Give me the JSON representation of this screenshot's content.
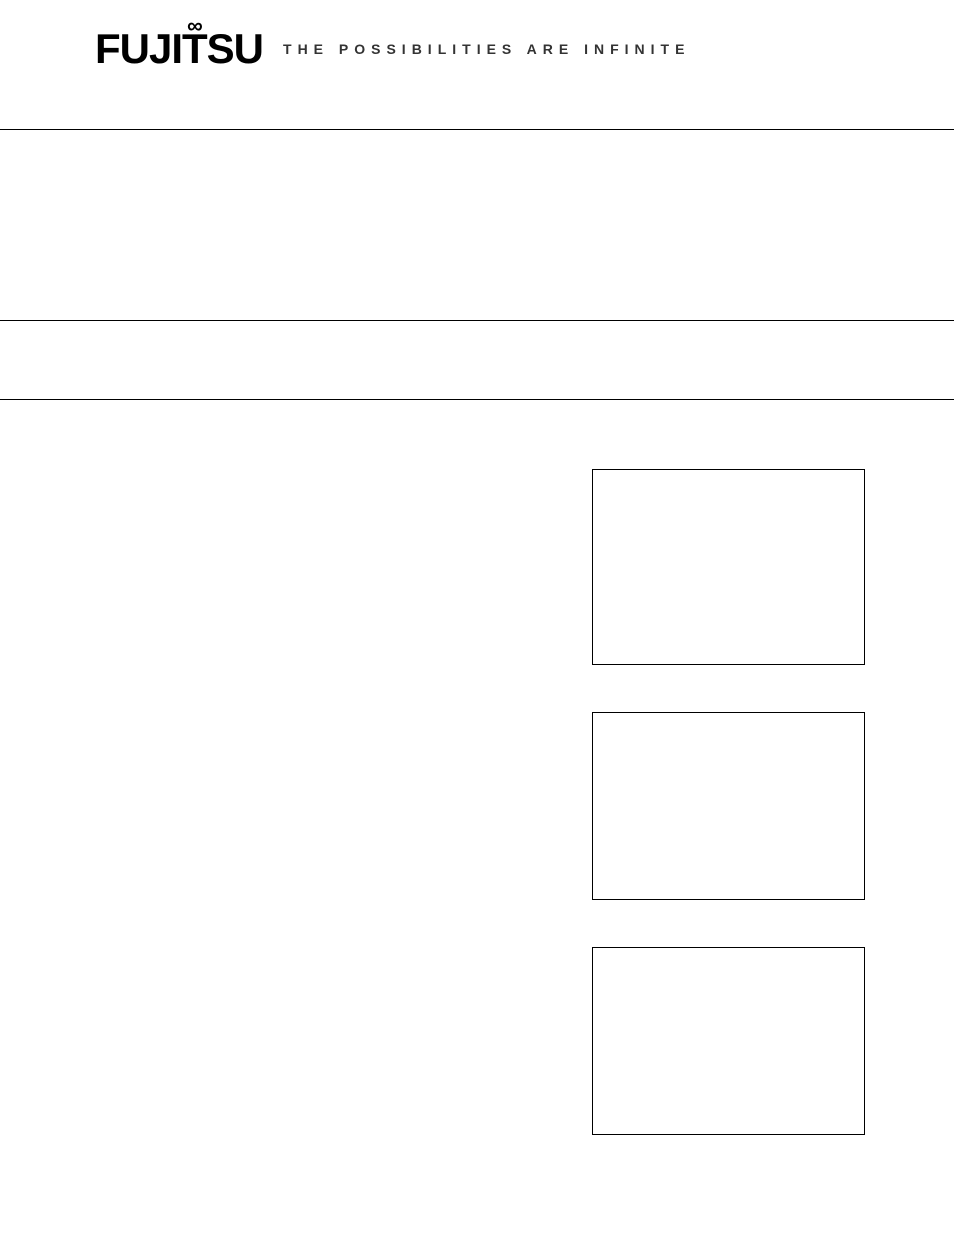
{
  "header": {
    "logo_text": "FUJITSU",
    "tagline": "THE POSSIBILITIES ARE INFINITE"
  }
}
